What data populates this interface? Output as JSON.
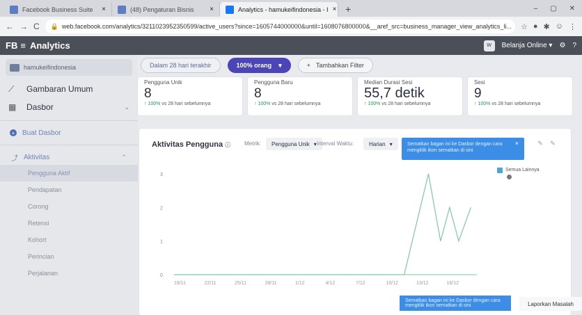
{
  "browser": {
    "tabs": [
      {
        "title": "Facebook Business Suite",
        "color": "#4267b2"
      },
      {
        "title": "(48) Pengaturan Bisnis",
        "color": "#4267b2"
      },
      {
        "title": "Analytics - hamukeifindonesia - I",
        "color": "#1877f2"
      }
    ],
    "url": "web.facebook.com/analytics/321102395235059​9/active_users?since=1605744000000&until=1608076800000&__aref_src=business_manager_view_analytics_li..."
  },
  "appbar": {
    "title": "FB",
    "section": "Analytics",
    "status": "Belanja Online"
  },
  "sidebar": {
    "account": "hamukeifindonesia",
    "nav": [
      {
        "label": "Gambaran Umum"
      },
      {
        "label": "Dasbor"
      }
    ],
    "create": "Buat Dasbor",
    "activity_label": "Aktivitas",
    "subitems": [
      "Pengguna Aktif",
      "Pendapatan",
      "Corong",
      "Retensi",
      "Kohort",
      "Perincian",
      "Perjalanan"
    ],
    "active_index": 0
  },
  "filters": {
    "range": "Dalam 28 hari terakhir",
    "audience": "100% orang",
    "add": "Tambahkan Filter"
  },
  "cards": [
    {
      "label": "Pengguna Unik",
      "value": "8",
      "delta": "↑ 100%",
      "cmp": " vs 28 hari sebelumnya"
    },
    {
      "label": "Pengguna Baru",
      "value": "8",
      "delta": "↑ 100%",
      "cmp": " vs 28 hari sebelumnya"
    },
    {
      "label": "Median Durasi Sesi",
      "value": "55,7 detik",
      "delta": "↑ 100%",
      "cmp": " vs 28 hari sebelumnya"
    },
    {
      "label": "Sesi",
      "value": "9",
      "delta": "↑ 100%",
      "cmp": " vs 28 hari sebelumnya"
    }
  ],
  "panel": {
    "title": "Aktivitas Pengguna",
    "metric_label": "Metrik:",
    "metric_value": "Pengguna Unik",
    "interval_label": "Interval Waktu:",
    "interval_value": "Harian",
    "tooltip": "Sematkan bagan ini ke Dasbor dengan cara mengklik ikon sematkan di sini",
    "legend": "Semua Lainnya"
  },
  "chart_data": {
    "type": "line",
    "x": [
      "19/11",
      "22/11",
      "25/11",
      "28/11",
      "1/12",
      "4/12",
      "7/12",
      "10/12",
      "13/12",
      "16/12"
    ],
    "y_ticks": [
      "3",
      "2",
      "1",
      "0"
    ],
    "series": [
      {
        "name": "Semua Lainnya",
        "points": [
          [
            0,
            0
          ],
          [
            1,
            0
          ],
          [
            2,
            0
          ],
          [
            3,
            0
          ],
          [
            4,
            0
          ],
          [
            5,
            0
          ],
          [
            6,
            0
          ],
          [
            7,
            0
          ],
          [
            7.6,
            0
          ],
          [
            8.4,
            3
          ],
          [
            8.8,
            1
          ],
          [
            9.1,
            2
          ],
          [
            9.4,
            1
          ],
          [
            9.8,
            2
          ]
        ],
        "color": "#7ec9a0"
      }
    ],
    "ylim": [
      0,
      3
    ],
    "xlim": [
      0,
      10
    ]
  },
  "bottom": {
    "tooltip": "Sematkan bagan ini ke Dasbor dengan cara mengklik ikon sematkan di sini",
    "report": "Laporkan Masalah"
  }
}
